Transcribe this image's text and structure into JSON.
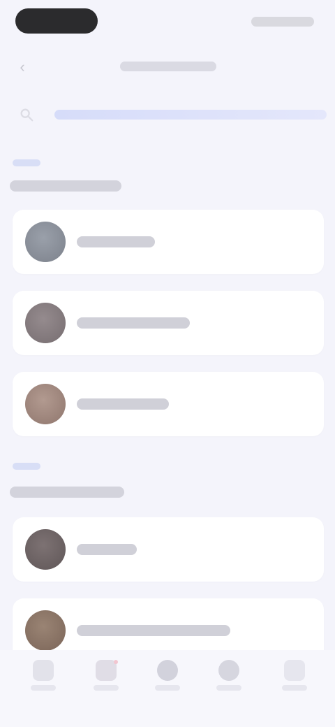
{
  "status_bar": {},
  "header": {
    "title": ""
  },
  "search": {
    "placeholder": ""
  },
  "sections": [
    {
      "caption": "",
      "title": "",
      "contacts": [
        {
          "name": "",
          "avatar_color": "#8b909a"
        },
        {
          "name": "",
          "avatar_color": "#8a8083"
        },
        {
          "name": "",
          "avatar_color": "#a4897f"
        }
      ]
    },
    {
      "caption": "",
      "title": "",
      "contacts": [
        {
          "name": "",
          "avatar_color": "#6f6566"
        },
        {
          "name": "",
          "avatar_color": "#8d7769"
        }
      ]
    }
  ],
  "tabs": [
    {
      "icon": "home-icon",
      "label": ""
    },
    {
      "icon": "heart-icon",
      "label": ""
    },
    {
      "icon": "chat-icon",
      "label": ""
    },
    {
      "icon": "people-icon",
      "label": ""
    },
    {
      "icon": "profile-icon",
      "label": ""
    }
  ],
  "colors": {
    "background": "#f4f4fb",
    "card": "#ffffff",
    "accent": "#d6dcf9"
  }
}
